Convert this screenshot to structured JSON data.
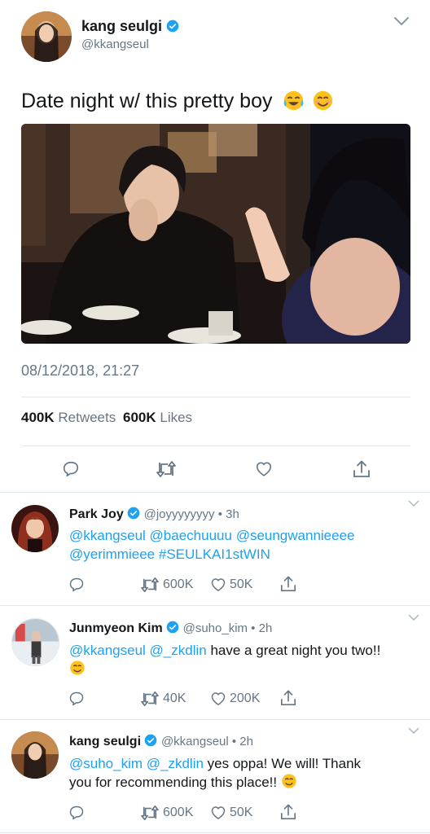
{
  "tweet": {
    "author_name": "kang seulgi",
    "handle": "@kkangseul",
    "text": "Date night w/ this pretty boy",
    "emojis": [
      "laughing-tears",
      "smiling-face"
    ],
    "timestamp": "08/12/2018, 21:27",
    "retweets_count": "400K",
    "retweets_label": "Retweets",
    "likes_count": "600K",
    "likes_label": "Likes"
  },
  "replies": [
    {
      "name": "Park Joy",
      "handle_time": "@joyyyyyyyy • 3h",
      "line1": [
        "@kkangseul",
        "@baechuuuu",
        "@seungwannieeee"
      ],
      "line2": [
        "@yerimmieee",
        "#SEULKAI1stWIN"
      ],
      "retweets": "600K",
      "likes": "50K"
    },
    {
      "name": "Junmyeon Kim",
      "handle_time": "@suho_kim • 2h",
      "mentions": [
        "@kkangseul",
        "@_zkdlin"
      ],
      "text": "have a great night you two!!",
      "retweets": "40K",
      "likes": "200K"
    },
    {
      "name": "kang seulgi",
      "handle_time": "@kkangseul • 2h",
      "mentions": [
        "@suho_kim",
        "@_zkdlin"
      ],
      "text": "yes oppa! We will! Thank",
      "text2": "you for recommending this place!!",
      "retweets": "600K",
      "likes": "50K"
    }
  ],
  "colors": {
    "accent": "#1da1f2",
    "text": "#14171a",
    "secondary": "#657786",
    "divider": "#e1e8ed"
  }
}
